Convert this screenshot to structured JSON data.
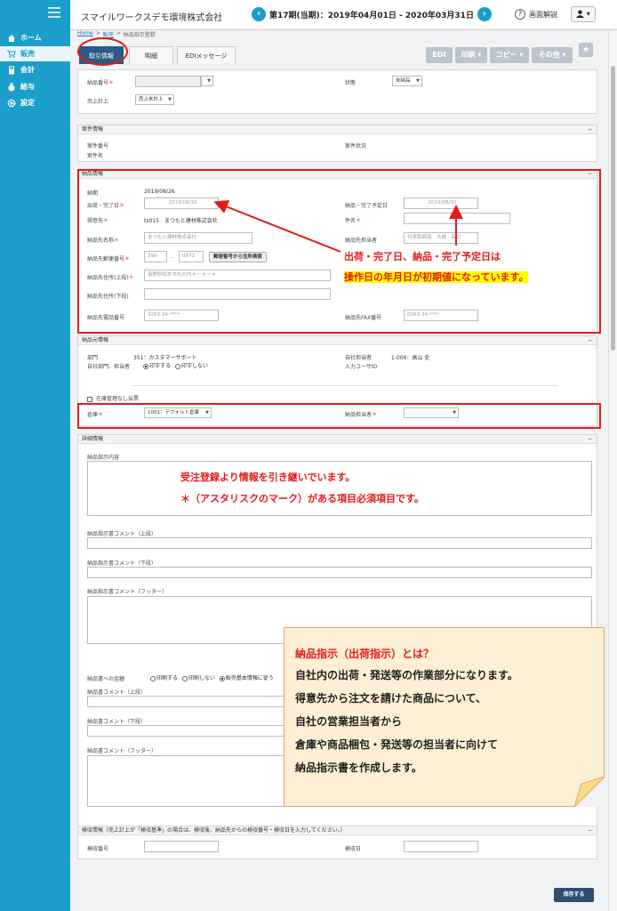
{
  "sidebar": {
    "items": [
      {
        "label": "ホーム",
        "icon": "home-icon"
      },
      {
        "label": "販売",
        "icon": "cart-icon"
      },
      {
        "label": "会計",
        "icon": "calculator-icon"
      },
      {
        "label": "給与",
        "icon": "money-bag-icon"
      },
      {
        "label": "設定",
        "icon": "gear-icon"
      }
    ]
  },
  "header": {
    "company": "スマイルワークスデモ環境株式会社",
    "prev": "‹",
    "next": "›",
    "period": "第17期(当期)：2019年04月01日 - 2020年03月31日",
    "help": "画面解説",
    "user": "▾"
  },
  "breadcrumb": {
    "home": "Home",
    "sales": "販売",
    "sep": ">",
    "current": "納品指示登録"
  },
  "tabs": [
    "取引情報",
    "明細",
    "EDIメッセージ"
  ],
  "toolbar": {
    "edi": "EDI",
    "print": "印刷 ▾",
    "copy": "コピー ▾",
    "other": "その他 ▾",
    "pin": "★"
  },
  "top": {
    "delivery_no": "納品番号",
    "status": "状態",
    "status_value": "未納品",
    "sales_posting": "売上計上",
    "sales_posting_value": "売上未計上"
  },
  "project": {
    "title": "案件情報",
    "no": "案件番号",
    "status": "案件状況",
    "name": "案件名"
  },
  "delivery": {
    "title": "納品情報",
    "due": "納期",
    "due_value": "2019/08/26",
    "ship_date": "出荷・完了日",
    "ship_date_value": "2019/08/10",
    "complete_date": "納品・完了予定日",
    "complete_date_value": "2019/08/10",
    "customer": "得意先",
    "customer_value": "ts015　まつもと建材株式会社",
    "subject": "件名",
    "dest_name": "納品先名称",
    "dest_name_value": "まつもと建材株式会社",
    "dest_person": "納品先担当者",
    "dest_person_value": "代表取締役　大越　宏之",
    "zip": "納品先郵便番号",
    "zip1": "390",
    "zip2": "0873",
    "zip_search": "郵便番号から住所検索",
    "addr1": "納品先住所(上段)",
    "addr1_value": "長野県松本市丸の内＊－＊－＊",
    "addr2": "納品先住所(下段)",
    "tel": "納品先電話番号",
    "tel_value": "0263-34-****",
    "fax": "納品先FAX番号",
    "fax_value": "0263-34-****"
  },
  "annot1": {
    "line1": "出荷・完了日、納品・完了予定日は",
    "line2": "操作日の年月日が初期値になっています。"
  },
  "source": {
    "title": "納品元情報",
    "dept": "部門",
    "dept_value": "351：カスタマーサポート",
    "own_person": "自社担当者",
    "own_person_value": "1-006：高山 史",
    "own_dept_print": "自社部門、担当者",
    "print_on": "印字する",
    "print_off": "印字しない",
    "input_user": "入力ユーザID",
    "no_stock": "在庫管理なし伝票",
    "warehouse": "倉庫",
    "warehouse_value": "1001：デフォルト倉庫",
    "delivery_person": "納品担当者"
  },
  "detail": {
    "title": "詳細情報",
    "instruction": "納品指示内容",
    "comment_top": "納品指示書コメント（上段）",
    "comment_bottom": "納品指示書コメント（下段）",
    "comment_footer": "納品指示書コメント（フッター）",
    "seal": "納品書への金額",
    "seal_opt1": "印刷する",
    "seal_opt2": "印刷しない",
    "seal_opt3": "販売基本情報に従う",
    "slip_top": "納品書コメント（上段）",
    "slip_bottom": "納品書コメント（下段）",
    "slip_footer": "納品書コメント（フッター）"
  },
  "annot2": {
    "line1": "受注登録より情報を引き継いでいます。",
    "line2": "＊（アスタリスクのマーク）がある項目必須項目です。"
  },
  "note": {
    "lines": [
      "納品指示（出荷指示）とは？",
      "自社内の出荷・発送等の作業部分になります。",
      "得意先から注文を請けた商品について、",
      "自社の営業担当者から",
      "倉庫や商品梱包・発送等の担当者に向けて",
      "納品指示書を作成します。"
    ]
  },
  "inspect": {
    "title": "検収情報（売上計上が「検収基準」の場合は、検収後、納品先からの検収番号・検収日を入力してください。）",
    "no": "検収番号",
    "date": "検収日"
  },
  "save": "保存する",
  "colors": {
    "sidebar": "#1b9ec9",
    "annotation": "#e41a1a",
    "highlight": "#ffff00",
    "note_bg": "#fdefd5"
  }
}
